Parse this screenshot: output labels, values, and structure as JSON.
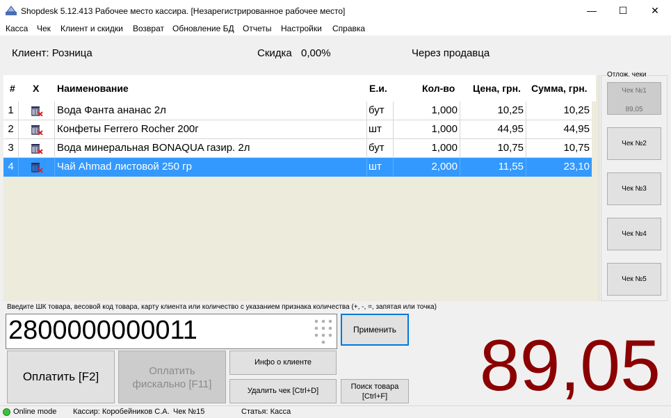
{
  "window": {
    "title": "Shopdesk 5.12.413 Рабочее место кассира. [Незарегистрированное рабочее место]",
    "minimize": "—",
    "maximize": "☐",
    "close": "✕"
  },
  "menu": [
    "Касса",
    "Чек",
    "Клиент и скидки",
    "Возврат",
    "Обновление БД",
    "Отчеты",
    "Настройки",
    "Справка"
  ],
  "info": {
    "client": "Клиент: Розница",
    "discount_label": "Скидка",
    "discount_value": "0,00%",
    "via": "Через продавца"
  },
  "table": {
    "headers": {
      "num": "#",
      "del": "X",
      "name": "Наименование",
      "unit": "Е.и.",
      "qty": "Кол-во",
      "price": "Цена, грн.",
      "sum": "Сумма, грн."
    },
    "rows": [
      {
        "num": "1",
        "name": "Вода Фанта ананас 2л",
        "unit": "бут",
        "qty": "1,000",
        "price": "10,25",
        "sum": "10,25"
      },
      {
        "num": "2",
        "name": "Конфеты Ferrero Rocher 200г",
        "unit": "шт",
        "qty": "1,000",
        "price": "44,95",
        "sum": "44,95"
      },
      {
        "num": "3",
        "name": "Вода минеральная BONAQUA газир. 2л",
        "unit": "бут",
        "qty": "1,000",
        "price": "10,75",
        "sum": "10,75"
      },
      {
        "num": "4",
        "name": "Чай Ahmad листовой 250 гр",
        "unit": "шт",
        "qty": "2,000",
        "price": "11,55",
        "sum": "23,10"
      }
    ],
    "selected_row": 4,
    "selection_color": "#3399ff"
  },
  "deferred": {
    "label": "Отлож. чеки",
    "checks": [
      {
        "label": "Чек №1",
        "amount": "89,05"
      },
      {
        "label": "Чек №2",
        "amount": ""
      },
      {
        "label": "Чек №3",
        "amount": ""
      },
      {
        "label": "Чек №4",
        "amount": ""
      },
      {
        "label": "Чек №5",
        "amount": ""
      }
    ]
  },
  "input": {
    "hint": "Введите ШК товара, весовой код товара,  карту клиента или количество с указанием признака количества (+, -, =, запятая или точка)",
    "barcode": "2800000000011",
    "apply": "Применить"
  },
  "buttons": {
    "pay": "Оплатить [F2]",
    "fiscal_line1": "Оплатить",
    "fiscal_line2": "фискально [F11]",
    "client_info": "Инфо о клиенте",
    "delete_check": "Удалить чек [Ctrl+D]",
    "search_line1": "Поиск товара",
    "search_line2": "[Ctrl+F]"
  },
  "total": {
    "value": "89,05",
    "color": "#8b0000"
  },
  "status": {
    "mode": "Online mode",
    "mode_color": "#3cc13c",
    "cashier": "Кассир: Коробейников С.А.",
    "check": "Чек №15",
    "article": "Статья: Касса"
  }
}
